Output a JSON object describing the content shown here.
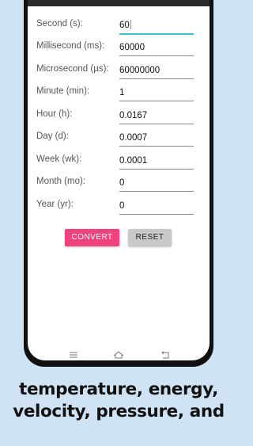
{
  "fields": [
    {
      "label": "Second (s):",
      "value": "60",
      "active": true
    },
    {
      "label": "Millisecond (ms):",
      "value": "60000"
    },
    {
      "label": "Microsecond (µs):",
      "value": "60000000"
    },
    {
      "label": "Minute (min):",
      "value": "1"
    },
    {
      "label": "Hour (h):",
      "value": "0.0167"
    },
    {
      "label": "Day (d):",
      "value": "0.0007"
    },
    {
      "label": "Week (wk):",
      "value": "0.0001"
    },
    {
      "label": "Month (mo):",
      "value": "0"
    },
    {
      "label": "Year (yr):",
      "value": "0"
    }
  ],
  "buttons": {
    "convert": "CONVERT",
    "reset": "RESET"
  },
  "colors": {
    "accent": "#36c2c8",
    "convert": "#f0427e",
    "reset": "#c8c8c8",
    "background": "#cfe3f4"
  },
  "navbar": {
    "icons": [
      "menu-icon",
      "home-icon",
      "back-icon"
    ]
  },
  "caption": {
    "line1": "temperature, energy,",
    "line2": "velocity, pressure, and"
  }
}
